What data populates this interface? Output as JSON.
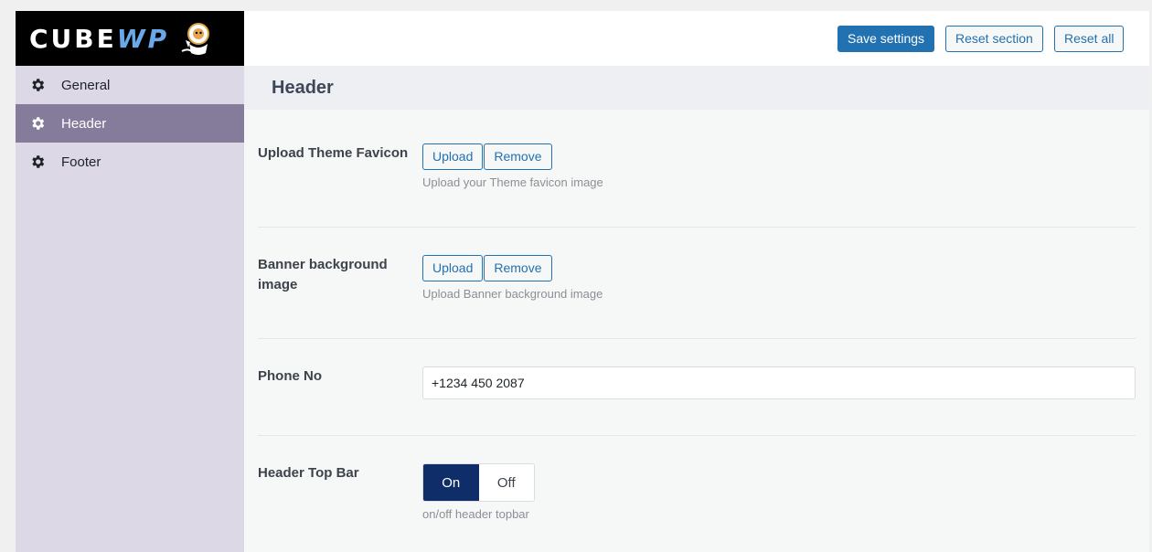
{
  "brand": {
    "logo_main": "CUBE",
    "logo_accent": "WP"
  },
  "sidebar": {
    "items": [
      {
        "label": "General",
        "icon": "gear-icon"
      },
      {
        "label": "Header",
        "icon": "gear-icon",
        "active": true
      },
      {
        "label": "Footer",
        "icon": "gear-icon"
      }
    ]
  },
  "toolbar": {
    "save_label": "Save settings",
    "reset_section_label": "Reset section",
    "reset_all_label": "Reset all"
  },
  "section": {
    "title": "Header"
  },
  "fields": {
    "favicon": {
      "label": "Upload Theme Favicon",
      "upload_label": "Upload",
      "remove_label": "Remove",
      "description": "Upload your Theme favicon image"
    },
    "banner": {
      "label": "Banner background image",
      "upload_label": "Upload",
      "remove_label": "Remove",
      "description": "Upload Banner background image"
    },
    "phone": {
      "label": "Phone No",
      "value": "+1234 450 2087"
    },
    "topbar": {
      "label": "Header Top Bar",
      "on_label": "On",
      "off_label": "Off",
      "selected": "On",
      "description": "on/off header topbar"
    }
  },
  "colors": {
    "primary": "#2271b1",
    "sidebar_bg": "#dcd8e6",
    "sidebar_active": "#857c9c",
    "toggle_on": "#0f2e69"
  }
}
